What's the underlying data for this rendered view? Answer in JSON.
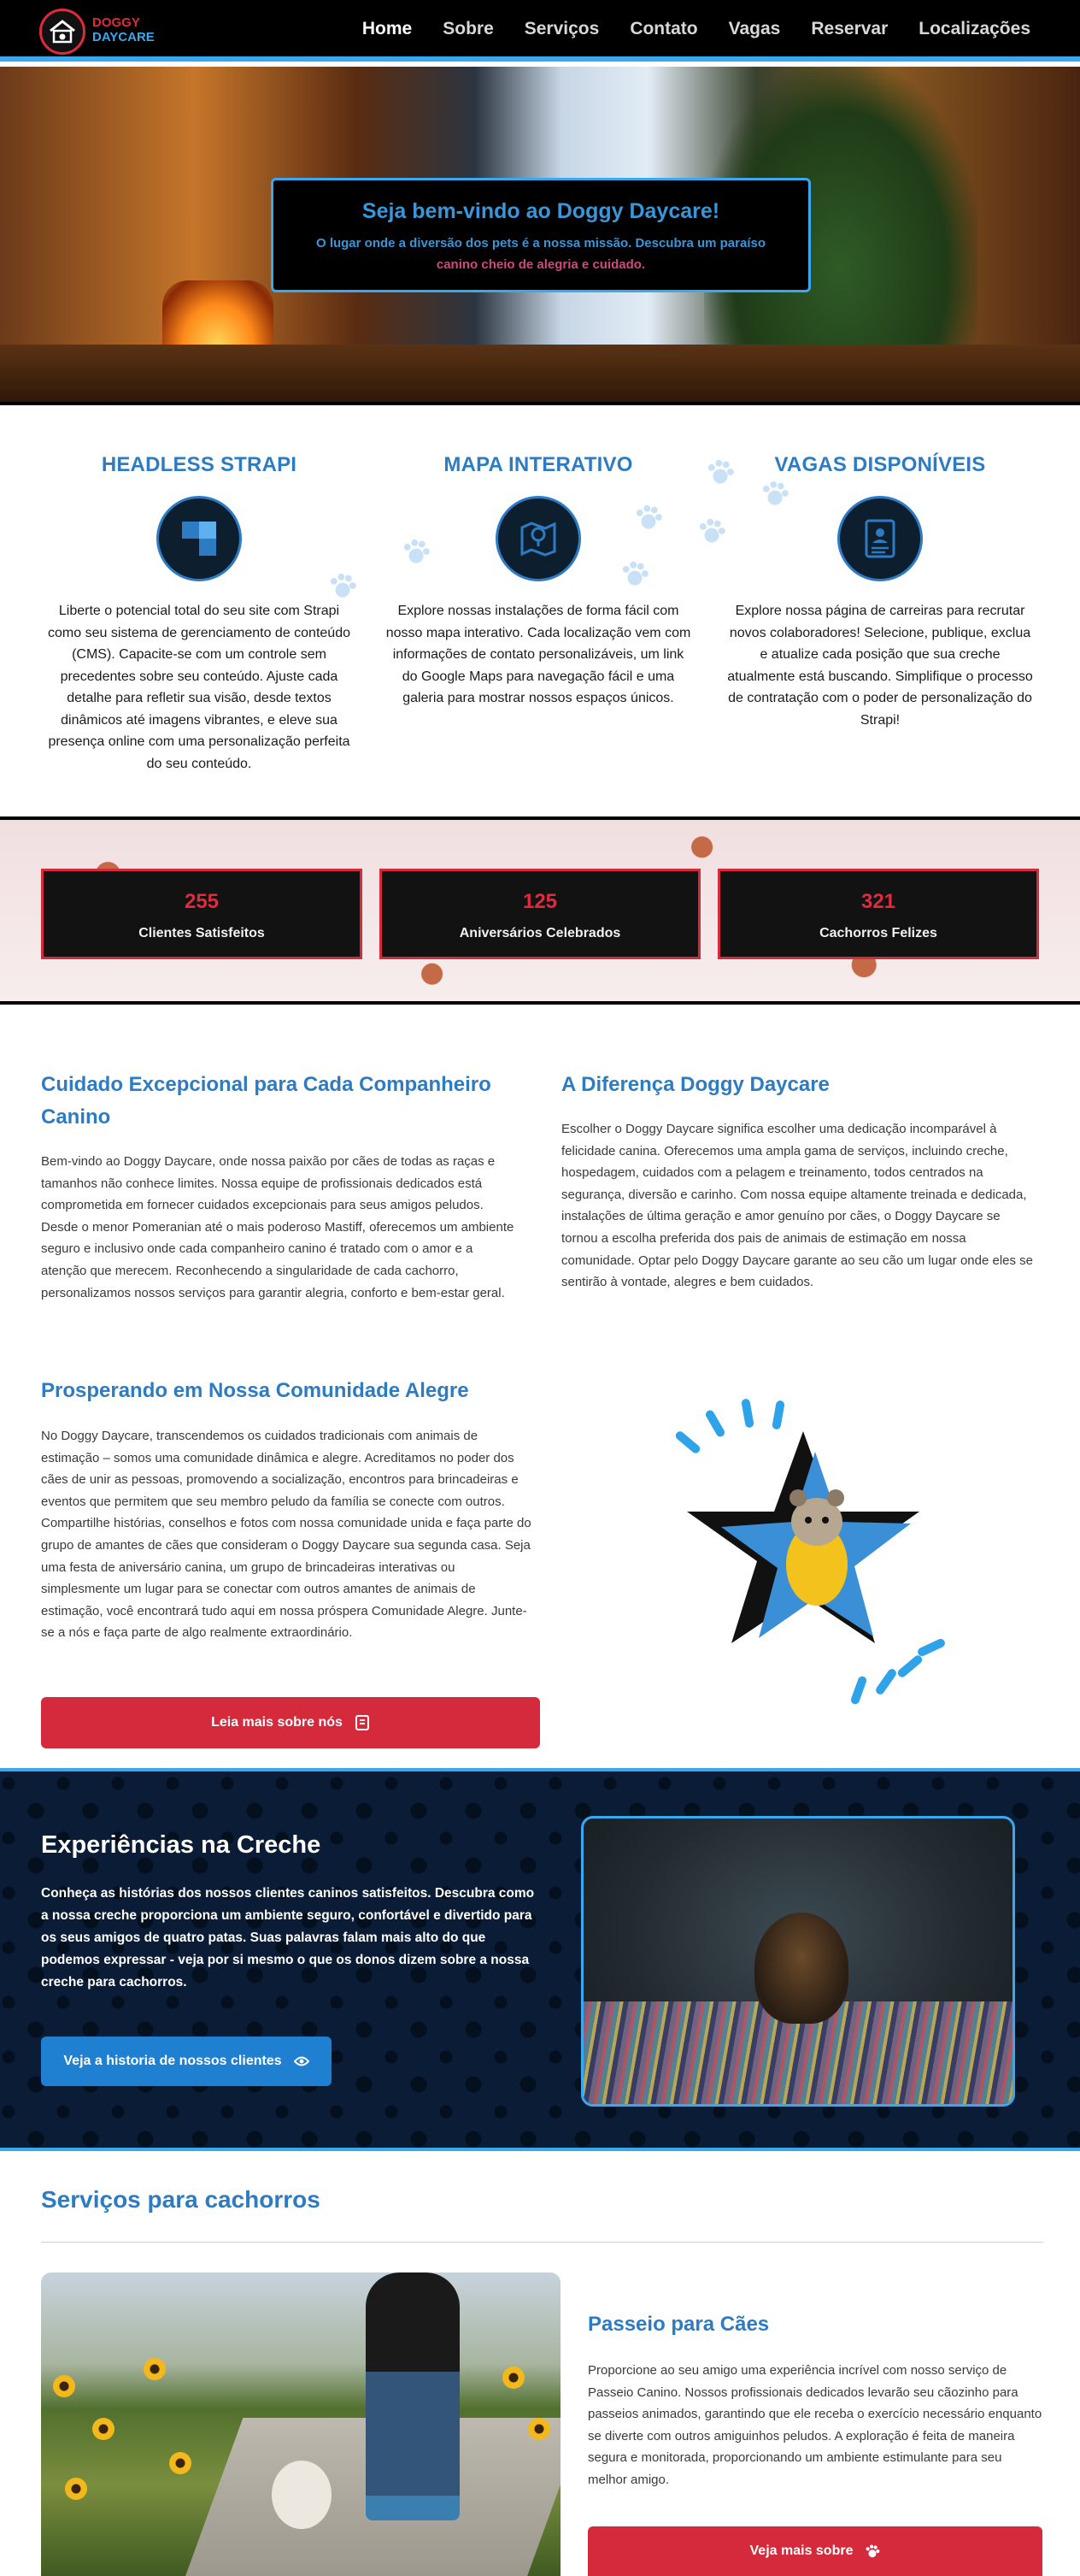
{
  "nav": {
    "logo_line1": "DOGGY",
    "logo_line2": "DAYCARE",
    "links": [
      "Home",
      "Sobre",
      "Serviços",
      "Contato",
      "Vagas",
      "Reservar",
      "Localizações"
    ]
  },
  "hero": {
    "title": "Seja bem-vindo ao Doggy Daycare!",
    "subtitle_part1": "O lugar onde a diversão dos pets é a nossa missão. Descubra um paraíso",
    "subtitle_part2": "canino cheio de alegria e cuidado."
  },
  "features": [
    {
      "title": "HEADLESS STRAPI",
      "icon": "strapi-logo-icon",
      "text": "Liberte o potencial total do seu site com Strapi como seu sistema de gerenciamento de conteúdo (CMS). Capacite-se com um controle sem precedentes sobre seu conteúdo. Ajuste cada detalhe para refletir sua visão, desde textos dinâmicos até imagens vibrantes, e eleve sua presença online com uma personalização perfeita do seu conteúdo."
    },
    {
      "title": "MAPA INTERATIVO",
      "icon": "map-pin-icon",
      "text": "Explore nossas instalações de forma fácil com nosso mapa interativo. Cada localização vem com informações de contato personalizáveis, um link do Google Maps para navegação fácil e uma galeria para mostrar nossos espaços únicos."
    },
    {
      "title": "VAGAS DISPONÍVEIS",
      "icon": "job-badge-icon",
      "text": "Explore nossa página de carreiras para recrutar novos colaboradores! Selecione, publique, exclua e atualize cada posição que sua creche atualmente está buscando. Simplifique o processo de contratação com o poder de personalização do Strapi!"
    }
  ],
  "stats": [
    {
      "number": "255",
      "label": "Clientes Satisfeitos"
    },
    {
      "number": "125",
      "label": "Aniversários Celebrados"
    },
    {
      "number": "321",
      "label": "Cachorros Felizes"
    }
  ],
  "about": {
    "care_title": "Cuidado Excepcional para Cada Companheiro Canino",
    "care_text": "Bem-vindo ao Doggy Daycare, onde nossa paixão por cães de todas as raças e tamanhos não conhece limites. Nossa equipe de profissionais dedicados está comprometida em fornecer cuidados excepcionais para seus amigos peludos. Desde o menor Pomeranian até o mais poderoso Mastiff, oferecemos um ambiente seguro e inclusivo onde cada companheiro canino é tratado com o amor e a atenção que merecem. Reconhecendo a singularidade de cada cachorro, personalizamos nossos serviços para garantir alegria, conforto e bem-estar geral.",
    "diff_title": "A Diferença Doggy Daycare",
    "diff_text": "Escolher o Doggy Daycare significa escolher uma dedicação incomparável à felicidade canina. Oferecemos uma ampla gama de serviços, incluindo creche, hospedagem, cuidados com a pelagem e treinamento, todos centrados na segurança, diversão e carinho. Com nossa equipe altamente treinada e dedicada, instalações de última geração e amor genuíno por cães, o Doggy Daycare se tornou a escolha preferida dos pais de animais de estimação em nossa comunidade. Optar pelo Doggy Daycare garante ao seu cão um lugar onde eles se sentirão à vontade, alegres e bem cuidados.",
    "community_title": "Prosperando em Nossa Comunidade Alegre",
    "community_text": "No Doggy Daycare, transcendemos os cuidados tradicionais com animais de estimação – somos uma comunidade dinâmica e alegre. Acreditamos no poder dos cães de unir as pessoas, promovendo a socialização, encontros para brincadeiras e eventos que permitem que seu membro peludo da família se conecte com outros. Compartilhe histórias, conselhos e fotos com nossa comunidade unida e faça parte do grupo de amantes de cães que consideram o Doggy Daycare sua segunda casa. Seja uma festa de aniversário canina, um grupo de brincadeiras interativas ou simplesmente um lugar para se conectar com outros amantes de animais de estimação, você encontrará tudo aqui em nossa próspera Comunidade Alegre. Junte-se a nós e faça parte de algo realmente extraordinário.",
    "read_more_label": "Leia mais sobre nós"
  },
  "creche": {
    "title": "Experiências na Creche",
    "text": "Conheça as histórias dos nossos clientes caninos satisfeitos. Descubra como a nossa creche proporciona um ambiente seguro, confortável e divertido para os seus amigos de quatro patas. Suas palavras falam mais alto do que podemos expressar - veja por si mesmo o que os donos dizem sobre a nossa creche para cachorros.",
    "button_label": "Veja a historia de nossos clientes"
  },
  "services": {
    "section_title": "Serviços para cachorros",
    "item_title": "Passeio para Cães",
    "item_text": "Proporcione ao seu amigo uma experiência incrível com nosso serviço de Passeio Canino. Nossos profissionais dedicados levarão seu cãozinho para passeios animados, garantindo que ele receba o exercício necessário enquanto se diverte com outros amiguinhos peludos. A exploração é feita de maneira segura e monitorada, proporcionando um ambiente estimulante para seu melhor amigo.",
    "button_label": "Veja mais sobre"
  },
  "colors": {
    "brand_blue": "#2d7cc3",
    "accent_blue": "#38a8f0",
    "brand_red": "#d42a3b",
    "nav_bg": "#000000",
    "creche_bg": "#0b1d36"
  }
}
